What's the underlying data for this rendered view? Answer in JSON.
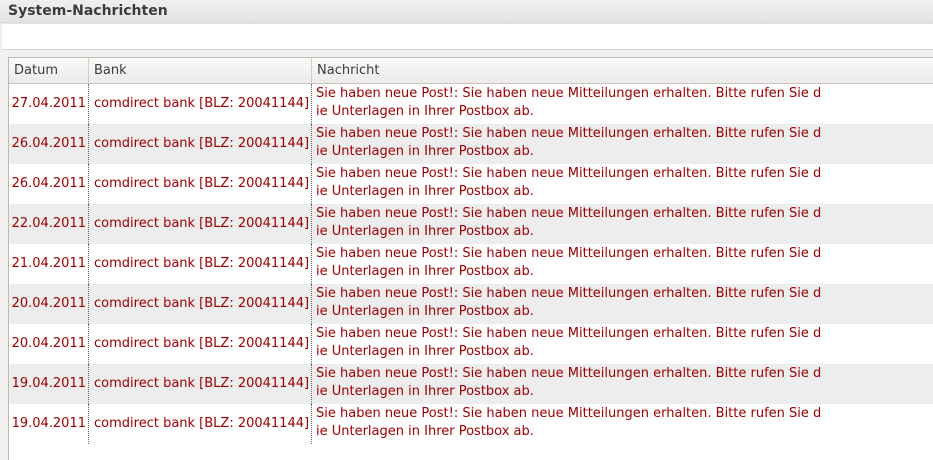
{
  "window": {
    "title": "System-Nachrichten"
  },
  "table": {
    "columns": [
      "Datum",
      "Bank",
      "Nachricht"
    ],
    "rows": [
      {
        "date": "27.04.2011",
        "bank": "comdirect bank [BLZ: 20041144]",
        "message_line1": "Sie haben neue Post!: Sie haben neue Mitteilungen erhalten. Bitte rufen Sie d",
        "message_line2": "ie Unterlagen in Ihrer Postbox ab."
      },
      {
        "date": "26.04.2011",
        "bank": "comdirect bank [BLZ: 20041144]",
        "message_line1": "Sie haben neue Post!: Sie haben neue Mitteilungen erhalten. Bitte rufen Sie d",
        "message_line2": "ie Unterlagen in Ihrer Postbox ab."
      },
      {
        "date": "26.04.2011",
        "bank": "comdirect bank [BLZ: 20041144]",
        "message_line1": "Sie haben neue Post!: Sie haben neue Mitteilungen erhalten. Bitte rufen Sie d",
        "message_line2": "ie Unterlagen in Ihrer Postbox ab."
      },
      {
        "date": "22.04.2011",
        "bank": "comdirect bank [BLZ: 20041144]",
        "message_line1": "Sie haben neue Post!: Sie haben neue Mitteilungen erhalten. Bitte rufen Sie d",
        "message_line2": "ie Unterlagen in Ihrer Postbox ab."
      },
      {
        "date": "21.04.2011",
        "bank": "comdirect bank [BLZ: 20041144]",
        "message_line1": "Sie haben neue Post!: Sie haben neue Mitteilungen erhalten. Bitte rufen Sie d",
        "message_line2": "ie Unterlagen in Ihrer Postbox ab."
      },
      {
        "date": "20.04.2011",
        "bank": "comdirect bank [BLZ: 20041144]",
        "message_line1": "Sie haben neue Post!: Sie haben neue Mitteilungen erhalten. Bitte rufen Sie d",
        "message_line2": "ie Unterlagen in Ihrer Postbox ab."
      },
      {
        "date": "20.04.2011",
        "bank": "comdirect bank [BLZ: 20041144]",
        "message_line1": "Sie haben neue Post!: Sie haben neue Mitteilungen erhalten. Bitte rufen Sie d",
        "message_line2": "ie Unterlagen in Ihrer Postbox ab."
      },
      {
        "date": "19.04.2011",
        "bank": "comdirect bank [BLZ: 20041144]",
        "message_line1": "Sie haben neue Post!: Sie haben neue Mitteilungen erhalten. Bitte rufen Sie d",
        "message_line2": "ie Unterlagen in Ihrer Postbox ab."
      },
      {
        "date": "19.04.2011",
        "bank": "comdirect bank [BLZ: 20041144]",
        "message_line1": "Sie haben neue Post!: Sie haben neue Mitteilungen erhalten. Bitte rufen Sie d",
        "message_line2": "ie Unterlagen in Ihrer Postbox ab."
      }
    ]
  },
  "colors": {
    "text_red": "#a00000",
    "row_alt": "#ededed",
    "row_plain": "#ffffff"
  }
}
